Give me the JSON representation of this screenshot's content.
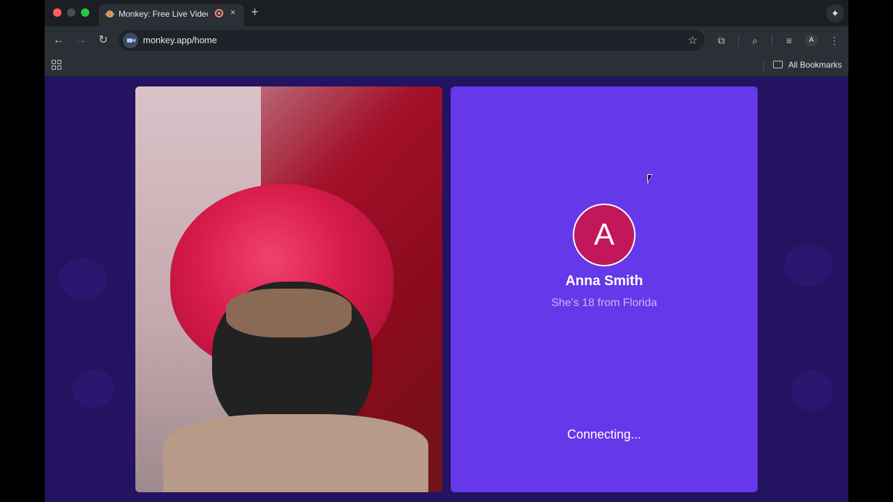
{
  "browser": {
    "tab": {
      "title": "Monkey: Free Live Video Chat",
      "favicon": "monkey-icon",
      "close_label": "×"
    },
    "new_tab_label": "+",
    "gemini_icon": "✦",
    "url": "monkey.app/home",
    "profile_initial": "A",
    "bookmarks": {
      "all_label": "All Bookmarks"
    }
  },
  "call": {
    "avatar_initial": "A",
    "name": "Anna Smith",
    "subtitle": "She's 18 from Florida",
    "status": "Connecting..."
  },
  "colors": {
    "page_bg": "#231361",
    "call_panel": "#6538ea",
    "avatar": "#c2185b"
  }
}
